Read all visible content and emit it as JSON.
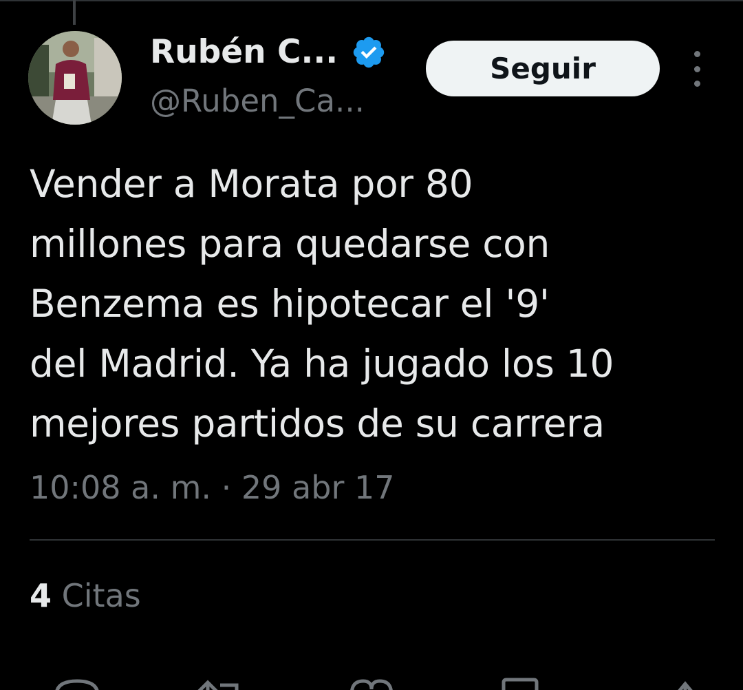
{
  "tweet": {
    "author": {
      "display_name": "Rubén C...",
      "handle": "@Ruben_Ca...",
      "verified": true,
      "avatar_icon": "profile-photo"
    },
    "follow_label": "Seguir",
    "text": "Vender a Morata por 80\nmillones para quedarse con\nBenzema es hipotecar el '9'\ndel Madrid. Ya ha jugado los 10\nmejores partidos de su carrera",
    "timestamp": "10:08 a. m. · 29 abr 17",
    "quotes": {
      "count": "4",
      "label": "Citas"
    }
  },
  "actions": [
    {
      "name": "reply",
      "icon": "reply-icon"
    },
    {
      "name": "retweet",
      "icon": "retweet-icon"
    },
    {
      "name": "like",
      "icon": "heart-icon"
    },
    {
      "name": "bookmark",
      "icon": "bookmark-icon"
    },
    {
      "name": "share",
      "icon": "share-icon"
    }
  ],
  "colors": {
    "background": "#000000",
    "primary_text": "#e7e9ea",
    "secondary_text": "#71767b",
    "verified_badge": "#1d9bf0",
    "follow_button_bg": "#eff3f4",
    "divider": "#2f3336"
  }
}
